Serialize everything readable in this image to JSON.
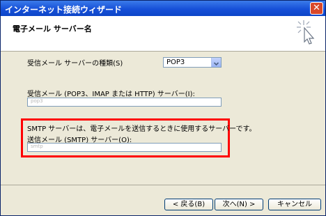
{
  "window": {
    "title": "インターネット接続ウィザード",
    "close_label": "✕"
  },
  "header": {
    "title": "電子メール サーバー名"
  },
  "form": {
    "incoming_type_label": "受信メール サーバーの種類(S)",
    "incoming_type_value": "POP3",
    "incoming_server_label": "受信メール (POP3、IMAP または HTTP) サーバー(I):",
    "incoming_server_value": "pop3",
    "smtp_note": "SMTP サーバーは、電子メールを送信するときに使用するサーバーです。",
    "outgoing_server_label": "送信メール (SMTP) サーバー(O):",
    "outgoing_server_value": "smtp"
  },
  "buttons": {
    "back": "< 戻る(B)",
    "next": "次へ(N) >",
    "cancel": "キャンセル"
  },
  "colors": {
    "titlebar": "#1650d8",
    "highlight_box": "#ff0000",
    "dialog_bg": "#ece9d8"
  }
}
